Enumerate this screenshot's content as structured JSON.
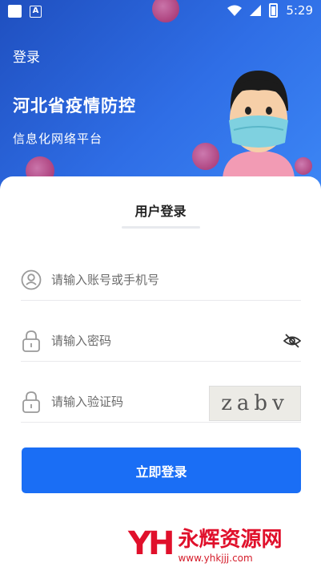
{
  "status_bar": {
    "time": "5:29",
    "a_label": "A"
  },
  "header": {
    "title": "登录",
    "headline": "河北省疫情防控",
    "subline": "信息化网络平台"
  },
  "login": {
    "tab": "用户登录",
    "account_placeholder": "请输入账号或手机号",
    "password_placeholder": "请输入密码",
    "captcha_placeholder": "请输入验证码",
    "captcha_text": "zabv",
    "submit_label": "立即登录"
  },
  "watermark": {
    "logo": "YH",
    "name": "永辉资源网",
    "url": "www.yhkjjj.com"
  },
  "colors": {
    "primary": "#1a6ef5",
    "banner": "#2f6ee6",
    "watermark": "#e0102b"
  }
}
